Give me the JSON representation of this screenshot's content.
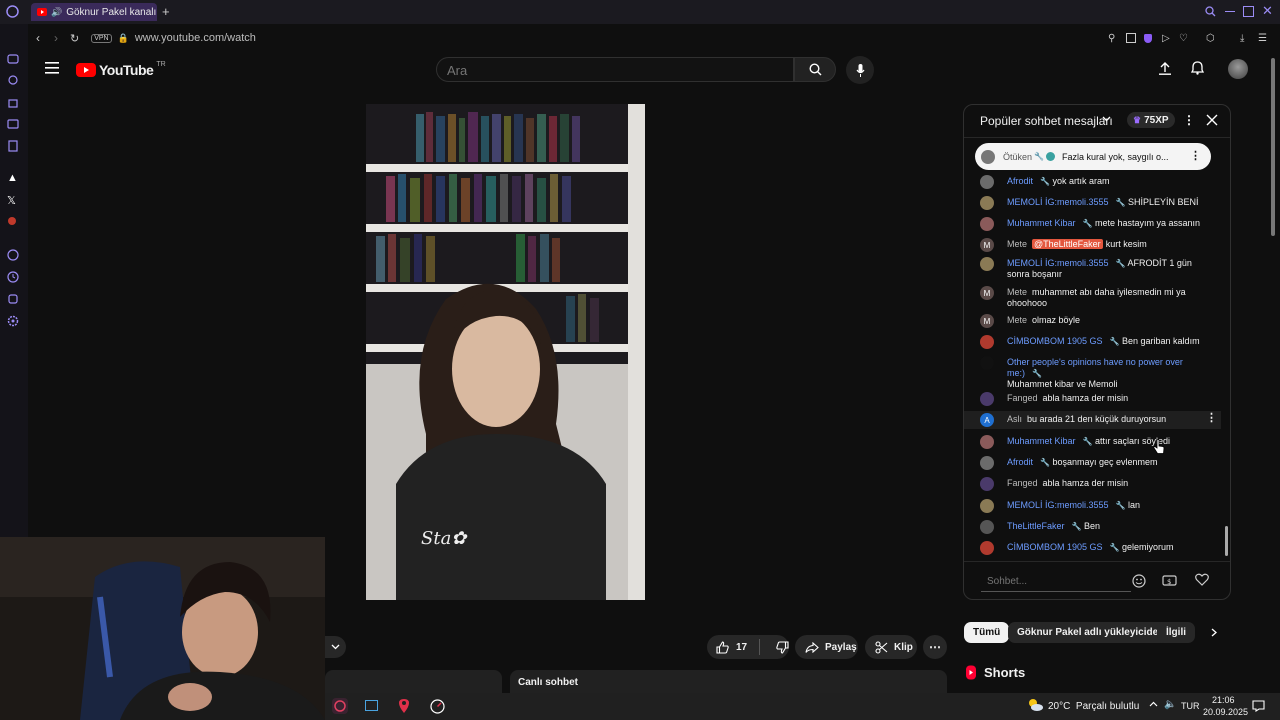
{
  "browser": {
    "tab_title": "Göknur Pakel kanalı ca",
    "vpn_label": "VPN",
    "url": "www.youtube.com/watch"
  },
  "youtube": {
    "logo_text": "YouTube",
    "region": "TR",
    "search_placeholder": "Ara"
  },
  "chat": {
    "title": "Popüler sohbet mesajları",
    "xp_badge": "75XP",
    "pinned": {
      "author": "Ötüken",
      "text": "Fazla kural yok, saygılı o..."
    },
    "messages": [
      {
        "author": "Afrodit",
        "text": "yok artık aram",
        "blue": true,
        "wrench": true,
        "avatar_color": "#6b6b6b"
      },
      {
        "author": "MEMOLİ İG:memoli.3555",
        "text": "SHİPLEYİN BENİ",
        "blue": true,
        "wrench": true,
        "avatar_color": "#8a7a55"
      },
      {
        "author": "Muhammet Kibar",
        "text": "mete hastayım ya assanın",
        "blue": true,
        "wrench": true,
        "avatar_color": "#8a5a5a"
      },
      {
        "author": "Mete",
        "mention": "@TheLittleFaker",
        "text": "kurt kesim",
        "blue": false,
        "wrench": false,
        "avatar_color": "#5a4a48",
        "avatar_letter": "M"
      },
      {
        "author": "MEMOLİ İG:memoli.3555",
        "text": "AFRODİT 1 gün sonra boşanır",
        "blue": true,
        "wrench": true,
        "avatar_color": "#8a7a55"
      },
      {
        "author": "Mete",
        "text": "muhammet abı daha iyilesmedin mi ya ohoohooo",
        "blue": false,
        "wrench": false,
        "avatar_color": "#5a4a48",
        "avatar_letter": "M"
      },
      {
        "author": "Mete",
        "text": "olmaz böyle",
        "blue": false,
        "wrench": false,
        "avatar_color": "#5a4a48",
        "avatar_letter": "M"
      },
      {
        "author": "CİMBOMBOM 1905 GS",
        "text": "Ben gariban kaldım",
        "blue": true,
        "wrench": true,
        "avatar_color": "#b03a2e"
      },
      {
        "author": "Other people's opinions have no power over me:)",
        "text": "Muhammet kibar ve Memoli",
        "blue": true,
        "wrench": true,
        "avatar_color": "#111111"
      },
      {
        "author": "Fanged",
        "text": "abla hamza der misin",
        "blue": false,
        "wrench": false,
        "avatar_color": "#4a3a6a"
      },
      {
        "author": "Aslı",
        "text": "bu arada 21 den küçük duruyorsun",
        "blue": false,
        "wrench": false,
        "avatar_color": "#1f6fd1",
        "avatar_letter": "A"
      },
      {
        "author": "Muhammet Kibar",
        "text": "attır saçları söyledi",
        "blue": true,
        "wrench": true,
        "avatar_color": "#8a5a5a"
      },
      {
        "author": "Afrodit",
        "text": "boşanmayı geç evlenmem",
        "blue": true,
        "wrench": true,
        "avatar_color": "#6b6b6b"
      },
      {
        "author": "Fanged",
        "text": "abla hamza der misin",
        "blue": false,
        "wrench": false,
        "avatar_color": "#4a3a6a"
      },
      {
        "author": "MEMOLİ İG:memoli.3555",
        "text": "lan",
        "blue": true,
        "wrench": true,
        "avatar_color": "#8a7a55"
      },
      {
        "author": "TheLittleFaker",
        "text": "Ben",
        "blue": true,
        "wrench": true,
        "avatar_color": "#555555"
      },
      {
        "author": "CİMBOMBOM 1905 GS",
        "text": "gelemiyorum",
        "blue": true,
        "wrench": true,
        "avatar_color": "#b03a2e"
      }
    ],
    "input_placeholder": "Sohbet..."
  },
  "actions": {
    "like_count": "17",
    "share_label": "Paylaş",
    "clip_label": "Klip"
  },
  "live_chat_label": "Canlı sohbet",
  "chips": [
    "Tümü",
    "Göknur Pakel adlı yükleyiciden",
    "İlgili"
  ],
  "shorts_label": "Shorts",
  "taskbar": {
    "weather": "20°C  Parçalı bulutlu",
    "language": "TUR",
    "time": "21:06",
    "date": "20.09.2025"
  },
  "colors": {
    "accent_red": "#ff0000",
    "link_blue": "#6d9cff",
    "browser_purple": "#3a2a5a"
  }
}
